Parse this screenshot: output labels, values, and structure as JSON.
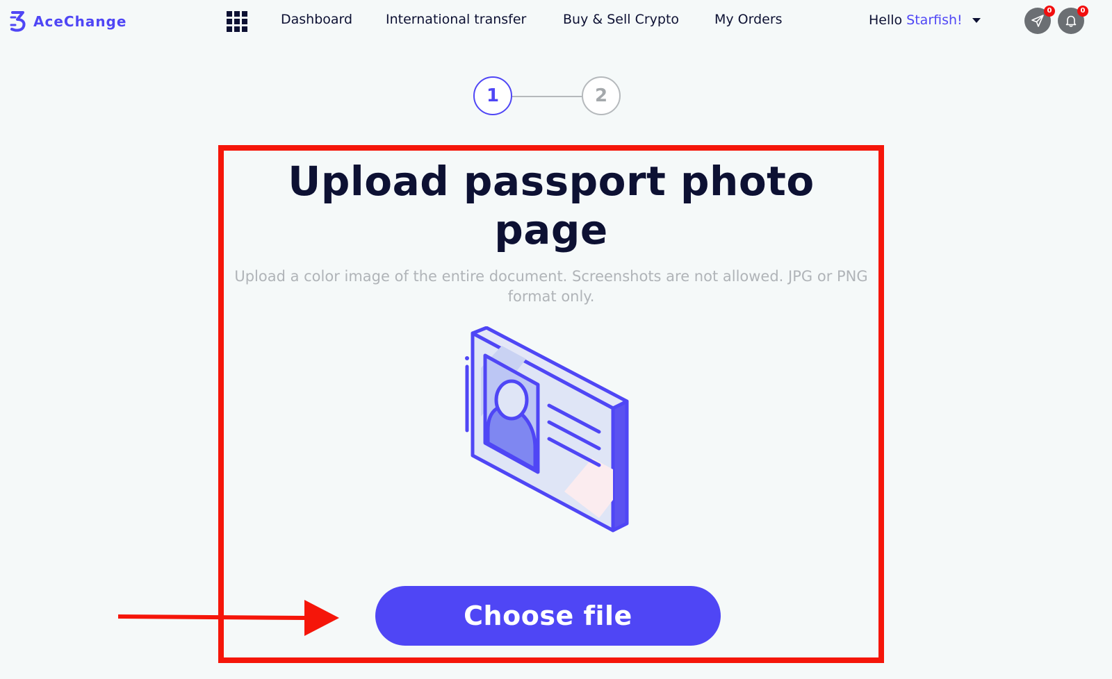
{
  "brand": {
    "name_prefix": "Ace",
    "name_suffix": "Change",
    "accent_color": "#4f46f5"
  },
  "nav": {
    "apps_icon": "grid-apps-icon",
    "links": [
      "Dashboard",
      "International transfer",
      "Buy & Sell Crypto",
      "My Orders"
    ]
  },
  "user": {
    "greeting": "Hello",
    "name": "Starfish!"
  },
  "toolbar": {
    "messages_icon": "paper-plane-icon",
    "messages_count": "0",
    "notifications_icon": "bell-icon",
    "notifications_count": "0",
    "badge_color": "#f20f0f"
  },
  "stepper": {
    "steps": [
      "1",
      "2"
    ],
    "current_step": 1
  },
  "upload": {
    "title": "Upload passport photo page",
    "instructions": "Upload a color image of the entire document. Screenshots are not allowed. JPG or PNG format only.",
    "illustration_icon": "id-card-icon",
    "button_label": "Choose file"
  },
  "annotations": {
    "highlight_color": "#f5160a",
    "arrow_icon": "red-arrow-right-icon"
  }
}
